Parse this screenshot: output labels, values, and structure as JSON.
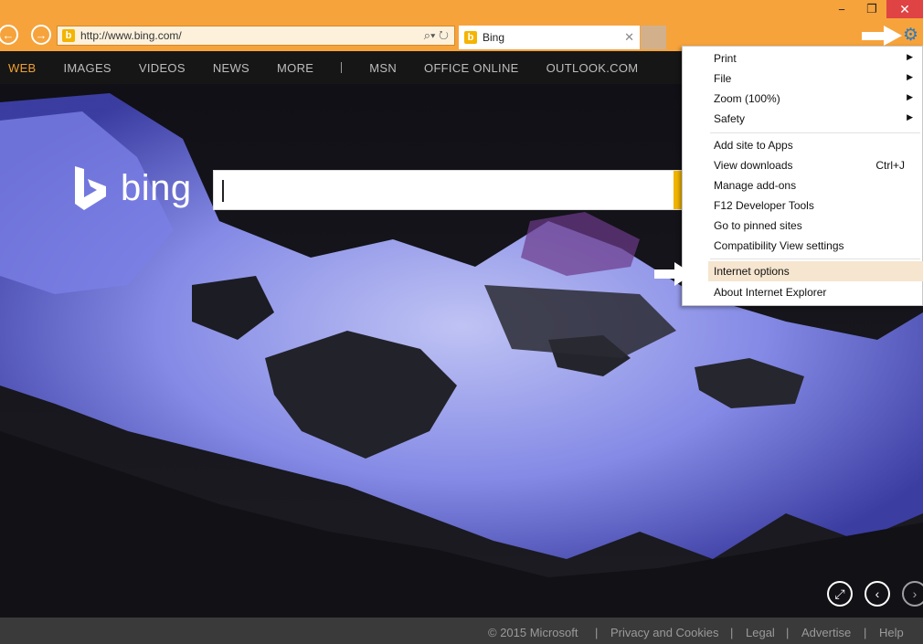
{
  "window": {
    "minimize_glyph": "−",
    "restore_glyph": "❐",
    "close_glyph": "✕"
  },
  "toolbar": {
    "back_glyph": "←",
    "forward_glyph": "→",
    "url": "http://www.bing.com/",
    "address_icons": "⌕▾ ↻",
    "favicon_letter": "b"
  },
  "tab": {
    "title": "Bing",
    "close_glyph": "✕"
  },
  "tools": {
    "icon": "gear-icon",
    "glyph": "⚙",
    "color": "#2a7abf"
  },
  "bing_nav": {
    "items": [
      "WEB",
      "IMAGES",
      "VIDEOS",
      "NEWS",
      "MORE"
    ],
    "extra_items": [
      "MSN",
      "OFFICE ONLINE",
      "OUTLOOK.COM"
    ],
    "active_color": "#f0a030"
  },
  "logo": {
    "text": "bing"
  },
  "hero_controls": {
    "expand_glyph": "⤢",
    "prev_glyph": "‹",
    "next_glyph": "›"
  },
  "footer": {
    "copyright": "© 2015 Microsoft",
    "links": [
      "Privacy and Cookies",
      "Legal",
      "Advertise",
      "Help"
    ],
    "separator": "|"
  },
  "tools_menu": {
    "items": [
      {
        "label": "Print",
        "submenu": true
      },
      {
        "label": "File",
        "submenu": true
      },
      {
        "label": "Zoom (100%)",
        "submenu": true
      },
      {
        "label": "Safety",
        "submenu": true
      },
      {
        "label": "Add site to Apps"
      },
      {
        "label": "View downloads",
        "shortcut": "Ctrl+J"
      },
      {
        "label": "Manage add-ons"
      },
      {
        "label": "F12 Developer Tools"
      },
      {
        "label": "Go to pinned sites"
      },
      {
        "label": "Compatibility View settings"
      },
      {
        "label": "Internet options",
        "highlighted": true
      },
      {
        "label": "About Internet Explorer"
      }
    ],
    "submenu_glyph": "▶"
  },
  "colors": {
    "chrome": "#f6a33c",
    "menu_highlight": "#f6e5cf",
    "footer_bg": "#3a3a3a"
  }
}
